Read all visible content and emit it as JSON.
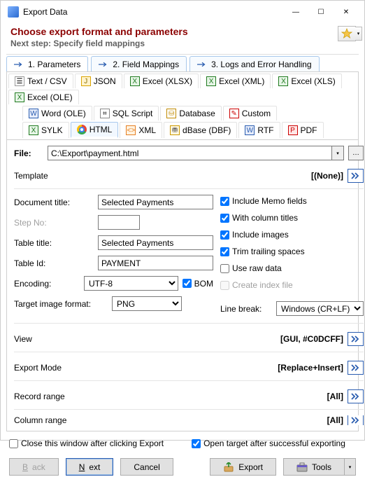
{
  "window": {
    "title": "Export Data"
  },
  "header": {
    "title": "Choose export format and parameters",
    "subtitle": "Next step: Specify field mappings"
  },
  "wizard_tabs": {
    "t1": "1. Parameters",
    "t2": "2. Field Mappings",
    "t3": "3. Logs and Error Handling"
  },
  "formats_row1": [
    {
      "key": "text",
      "label": "Text / CSV",
      "icon": "txt"
    },
    {
      "key": "json",
      "label": "JSON",
      "icon": "json"
    },
    {
      "key": "xlsx",
      "label": "Excel (XLSX)",
      "icon": "xlsx"
    },
    {
      "key": "xml",
      "label": "Excel (XML)",
      "icon": "xlsx"
    },
    {
      "key": "xls",
      "label": "Excel (XLS)",
      "icon": "xls"
    },
    {
      "key": "ole",
      "label": "Excel (OLE)",
      "icon": "xls"
    }
  ],
  "formats_row2": [
    {
      "key": "wordole",
      "label": "Word (OLE)",
      "icon": "word"
    },
    {
      "key": "sql",
      "label": "SQL Script",
      "icon": "sql"
    },
    {
      "key": "db",
      "label": "Database",
      "icon": "db"
    },
    {
      "key": "custom",
      "label": "Custom",
      "icon": "custom"
    }
  ],
  "formats_row3": [
    {
      "key": "sylk",
      "label": "SYLK",
      "icon": "sylk"
    },
    {
      "key": "html",
      "label": "HTML",
      "icon": "html",
      "active": true
    },
    {
      "key": "xmlf",
      "label": "XML",
      "icon": "xml"
    },
    {
      "key": "dbf",
      "label": "dBase (DBF)",
      "icon": "dbf"
    },
    {
      "key": "rtf",
      "label": "RTF",
      "icon": "rtf"
    },
    {
      "key": "pdf",
      "label": "PDF",
      "icon": "pdf"
    }
  ],
  "form": {
    "file_label": "File:",
    "file_value": "C:\\Export\\payment.html",
    "template_label": "Template",
    "template_value": "[(None)]",
    "doc_title_label": "Document title:",
    "doc_title_value": "Selected Payments",
    "step_no_label": "Step No:",
    "step_no_value": "",
    "table_title_label": "Table title:",
    "table_title_value": "Selected Payments",
    "table_id_label": "Table Id:",
    "table_id_value": "PAYMENT",
    "encoding_label": "Encoding:",
    "encoding_value": "UTF-8",
    "bom_label": "BOM",
    "target_img_label": "Target image format:",
    "target_img_value": "PNG",
    "checks": {
      "memo": "Include Memo fields",
      "cols": "With column titles",
      "imgs": "Include images",
      "trim": "Trim trailing spaces",
      "raw": "Use raw data",
      "idx": "Create index file"
    },
    "linebreak_label": "Line break:",
    "linebreak_value": "Windows (CR+LF)",
    "view_label": "View",
    "view_value": "[GUI, #C0DCFF]",
    "mode_label": "Export Mode",
    "mode_value": "[Replace+Insert]",
    "rec_label": "Record range",
    "rec_value": "[All]",
    "col_label": "Column range",
    "col_value": "[All]"
  },
  "footer": {
    "close_after": "Close this window after clicking Export",
    "open_after": "Open target after successful exporting"
  },
  "buttons": {
    "back": "Back",
    "next": "Next",
    "cancel": "Cancel",
    "export": "Export",
    "tools": "Tools"
  }
}
